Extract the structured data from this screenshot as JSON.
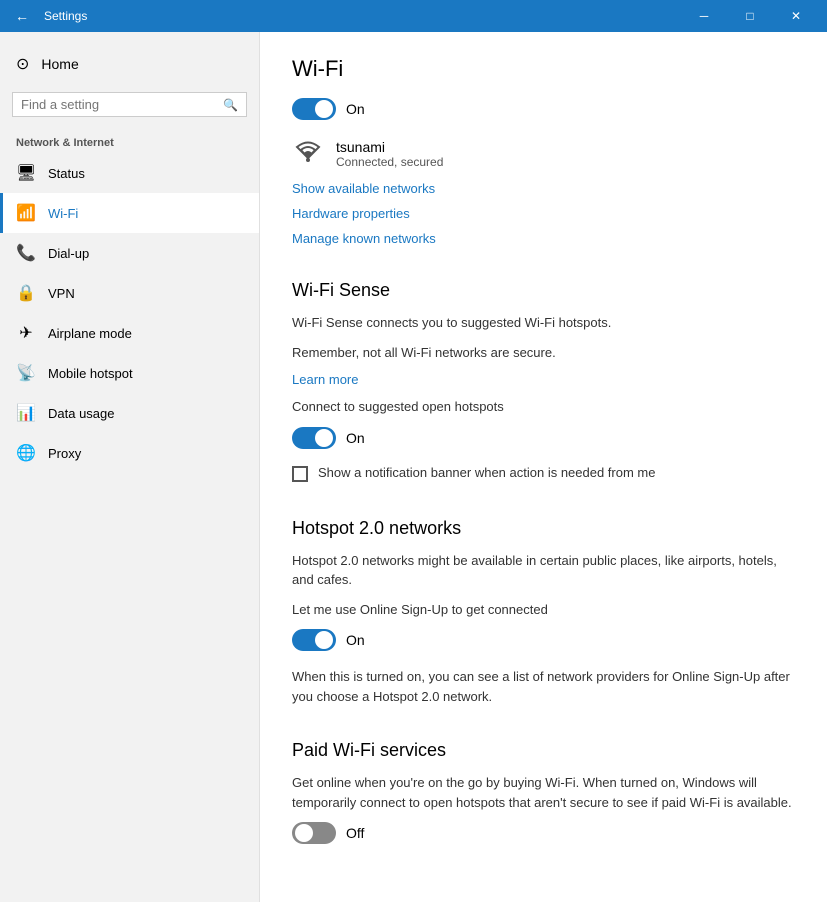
{
  "titlebar": {
    "back_icon": "←",
    "title": "Settings",
    "minimize_icon": "─",
    "maximize_icon": "□",
    "close_icon": "✕"
  },
  "sidebar": {
    "home_label": "Home",
    "search_placeholder": "Find a setting",
    "category": "Network & Internet",
    "items": [
      {
        "id": "status",
        "label": "Status",
        "icon": "🖥"
      },
      {
        "id": "wifi",
        "label": "Wi-Fi",
        "icon": "📶"
      },
      {
        "id": "dialup",
        "label": "Dial-up",
        "icon": "📞"
      },
      {
        "id": "vpn",
        "label": "VPN",
        "icon": "🔒"
      },
      {
        "id": "airplane",
        "label": "Airplane mode",
        "icon": "✈"
      },
      {
        "id": "hotspot",
        "label": "Mobile hotspot",
        "icon": "📡"
      },
      {
        "id": "datausage",
        "label": "Data usage",
        "icon": "📊"
      },
      {
        "id": "proxy",
        "label": "Proxy",
        "icon": "🌐"
      }
    ]
  },
  "main": {
    "wifi_title": "Wi-Fi",
    "wifi_toggle_state": "on",
    "wifi_toggle_label": "On",
    "network_name": "tsunami",
    "network_status": "Connected, secured",
    "show_networks_link": "Show available networks",
    "hardware_properties_link": "Hardware properties",
    "manage_networks_link": "Manage known networks",
    "wifi_sense_title": "Wi-Fi Sense",
    "wifi_sense_desc1": "Wi-Fi Sense connects you to suggested Wi-Fi hotspots.",
    "wifi_sense_desc2": "Remember, not all Wi-Fi networks are secure.",
    "learn_more_link": "Learn more",
    "connect_hotspots_label": "Connect to suggested open hotspots",
    "connect_toggle_state": "on",
    "connect_toggle_label": "On",
    "notification_checkbox_label": "Show a notification banner when action is needed from me",
    "hotspot_title": "Hotspot 2.0 networks",
    "hotspot_desc": "Hotspot 2.0 networks might be available in certain public places, like airports, hotels, and cafes.",
    "online_signup_label": "Let me use Online Sign-Up to get connected",
    "online_toggle_state": "on",
    "online_toggle_label": "On",
    "online_desc": "When this is turned on, you can see a list of network providers for Online Sign-Up after you choose a Hotspot 2.0 network.",
    "paid_wifi_title": "Paid Wi-Fi services",
    "paid_wifi_desc": "Get online when you're on the go by buying Wi-Fi. When turned on, Windows will temporarily connect to open hotspots that aren't secure to see if paid Wi-Fi is available.",
    "paid_toggle_state": "off",
    "paid_toggle_label": "Off"
  }
}
